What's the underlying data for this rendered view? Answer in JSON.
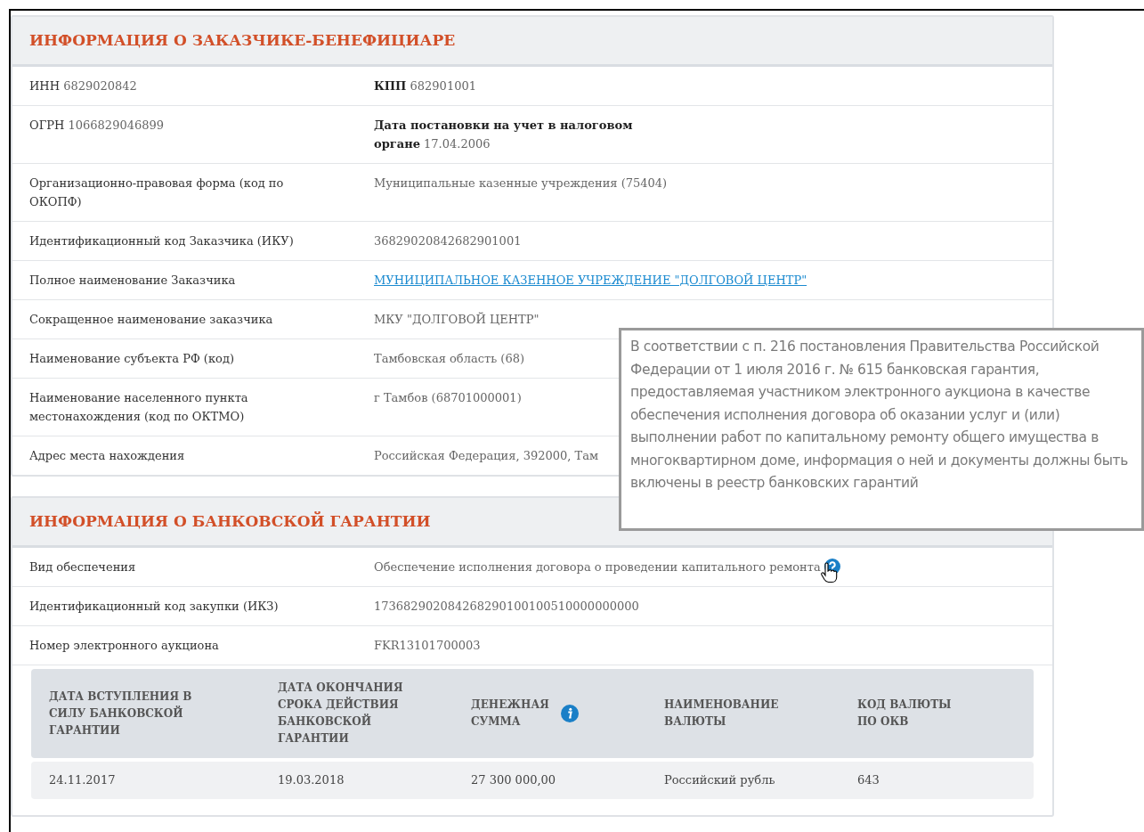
{
  "customer_section": {
    "title": "ИНФОРМАЦИЯ О ЗАКАЗЧИКЕ-БЕНЕФИЦИАРЕ",
    "rows": [
      {
        "kind": "inline",
        "cells": [
          {
            "label": "ИНН",
            "value": "6829020842"
          },
          {
            "label": "КПП",
            "value": "682901001"
          }
        ]
      },
      {
        "kind": "inline",
        "cells": [
          {
            "label": "ОГРН",
            "value": "1066829046899"
          },
          {
            "label": "Дата постановки на учет в налоговом органе",
            "value": "17.04.2006"
          }
        ]
      },
      {
        "kind": "field",
        "label": "Организационно-правовая форма (код по ОКОПФ)",
        "value": "Муниципальные казенные учреждения (75404)"
      },
      {
        "kind": "field",
        "label": "Идентификационный код Заказчика (ИКУ)",
        "value": "368290208426829010​01"
      },
      {
        "kind": "link",
        "label": "Полное наименование Заказчика",
        "value": "МУНИЦИПАЛЬНОЕ КАЗЕННОЕ УЧРЕЖДЕНИЕ \"ДОЛГОВОЙ ЦЕНТР\""
      },
      {
        "kind": "field",
        "label": "Сокращенное наименование заказчика",
        "value": "МКУ \"ДОЛГОВОЙ ЦЕНТР\""
      },
      {
        "kind": "field",
        "label": "Наименование субъекта РФ (код)",
        "value": "Тамбовская область (68)"
      },
      {
        "kind": "field",
        "label": "Наименование населенного пункта местонахождения (код по ОКТМО)",
        "value": "г Тамбов (68701000001)"
      },
      {
        "kind": "field",
        "label": "Адрес места нахождения",
        "value": "Российская Федерация, 392000, Там"
      }
    ]
  },
  "guarantee_section": {
    "title": "ИНФОРМАЦИЯ О БАНКОВСКОЙ ГАРАНТИИ",
    "rows": [
      {
        "kind": "help",
        "label": "Вид обеспечения",
        "value": "Обеспечение исполнения договора о проведении капитального ремонта"
      },
      {
        "kind": "field",
        "label": "Идентификационный код закупки (ИКЗ)",
        "value": "173682902084268290100100510000000000"
      },
      {
        "kind": "field",
        "label": "Номер электронного аукциона",
        "value": "FKR13101700003"
      }
    ],
    "table": {
      "columns": [
        {
          "label": "ДАТА ВСТУПЛЕНИЯ В СИЛУ БАНКОВСКОЙ ГАРАНТИИ",
          "kind": "plain"
        },
        {
          "label": "ДАТА ОКОНЧАНИЯ СРОКА ДЕЙСТВИЯ БАНКОВСКОЙ ГАРАНТИИ",
          "kind": "plain"
        },
        {
          "label": "ДЕНЕЖНАЯ СУММА",
          "kind": "info"
        },
        {
          "label": "НАИМЕНОВАНИЕ ВАЛЮТЫ",
          "kind": "plain"
        },
        {
          "label": "КОД ВАЛЮТЫ ПО ОКВ",
          "kind": "plain"
        }
      ],
      "rows": [
        [
          "24.11.2017",
          "19.03.2018",
          "27 300 000,00",
          "Российский рубль",
          "643"
        ]
      ]
    }
  },
  "tooltip": {
    "text": "В соответствии с п. 216 постановления Правительства Российской Федерации от 1 июля 2016 г. № 615 банковская гарантия, предоставляемая участником электронного аукциона в качестве обеспечения исполнения договора об оказании услуг и (или) выполнении работ по капитальному ремонту общего имущества в многоквартирном доме, информация о ней и документы должны быть включены в реестр банковских гарантий"
  }
}
